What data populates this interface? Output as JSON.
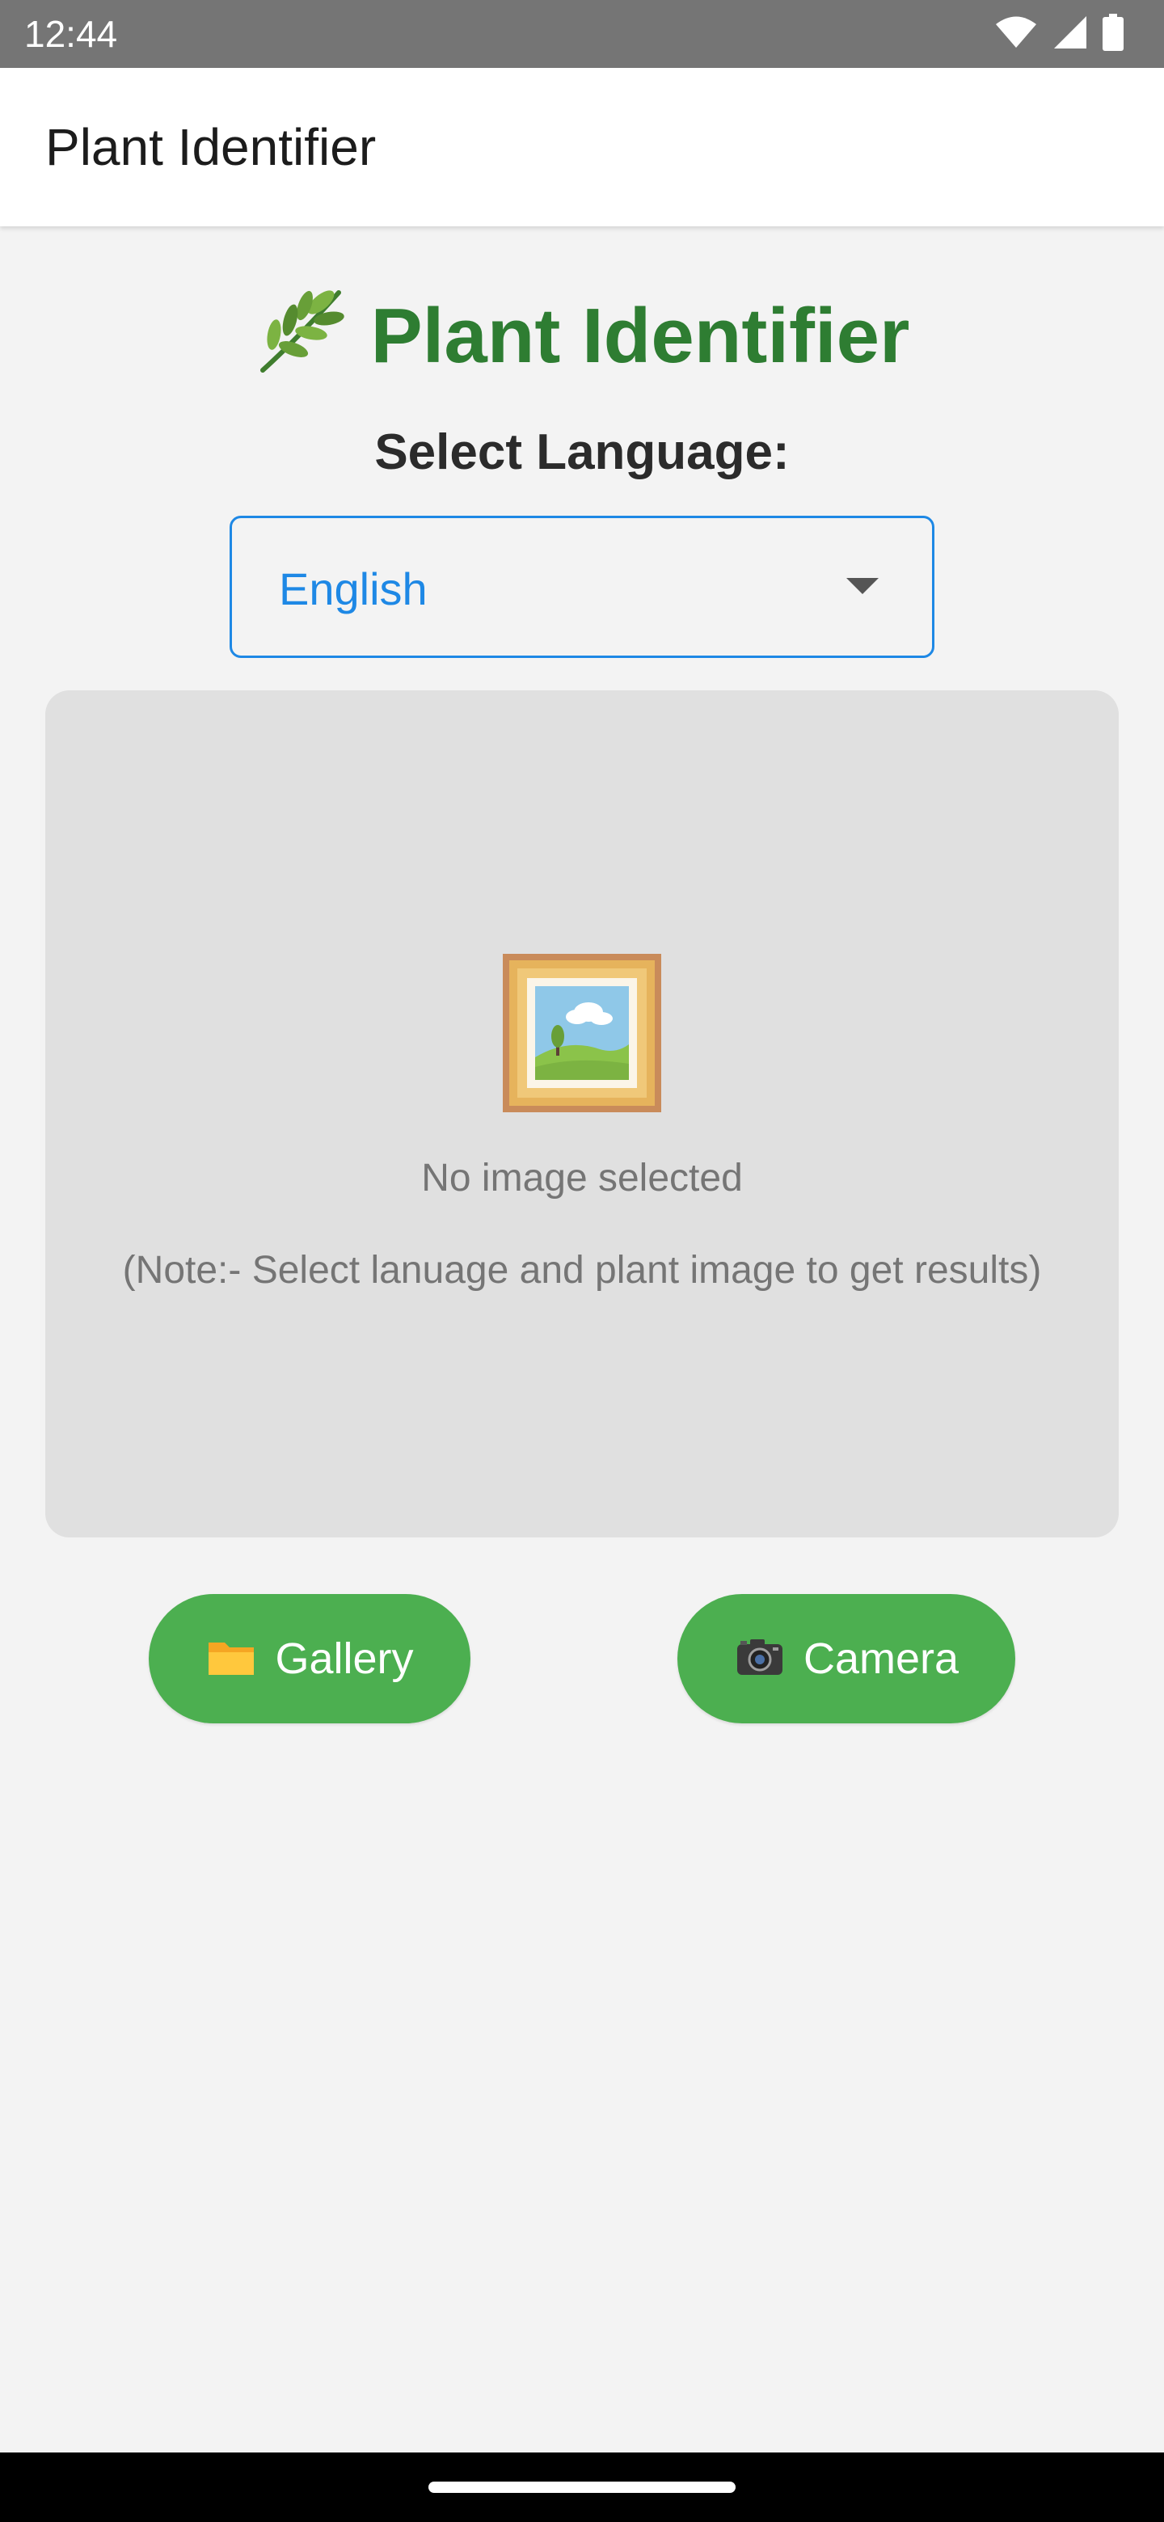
{
  "status_bar": {
    "time": "12:44",
    "icons": [
      "wifi-icon",
      "cellular-signal-icon",
      "battery-icon"
    ]
  },
  "app_bar": {
    "title": "Plant Identifier"
  },
  "main": {
    "heading": "Plant Identifier",
    "heading_icon": "herb-icon",
    "language_label": "Select Language:",
    "language_select": {
      "selected": "English"
    },
    "image_panel": {
      "placeholder_icon": "framed-picture-icon",
      "empty_text": "No image selected",
      "note": "(Note:- Select lanuage and plant image to get results)"
    },
    "buttons": {
      "gallery": {
        "label": "Gallery",
        "icon": "folder-icon"
      },
      "camera": {
        "label": "Camera",
        "icon": "camera-icon"
      }
    }
  },
  "colors": {
    "heading_green": "#2e7d32",
    "button_green": "#4caf50",
    "select_blue": "#1e88e5",
    "background": "#f3f3f3",
    "panel_gray": "#e0e0e0",
    "status_bar_gray": "#757575"
  }
}
